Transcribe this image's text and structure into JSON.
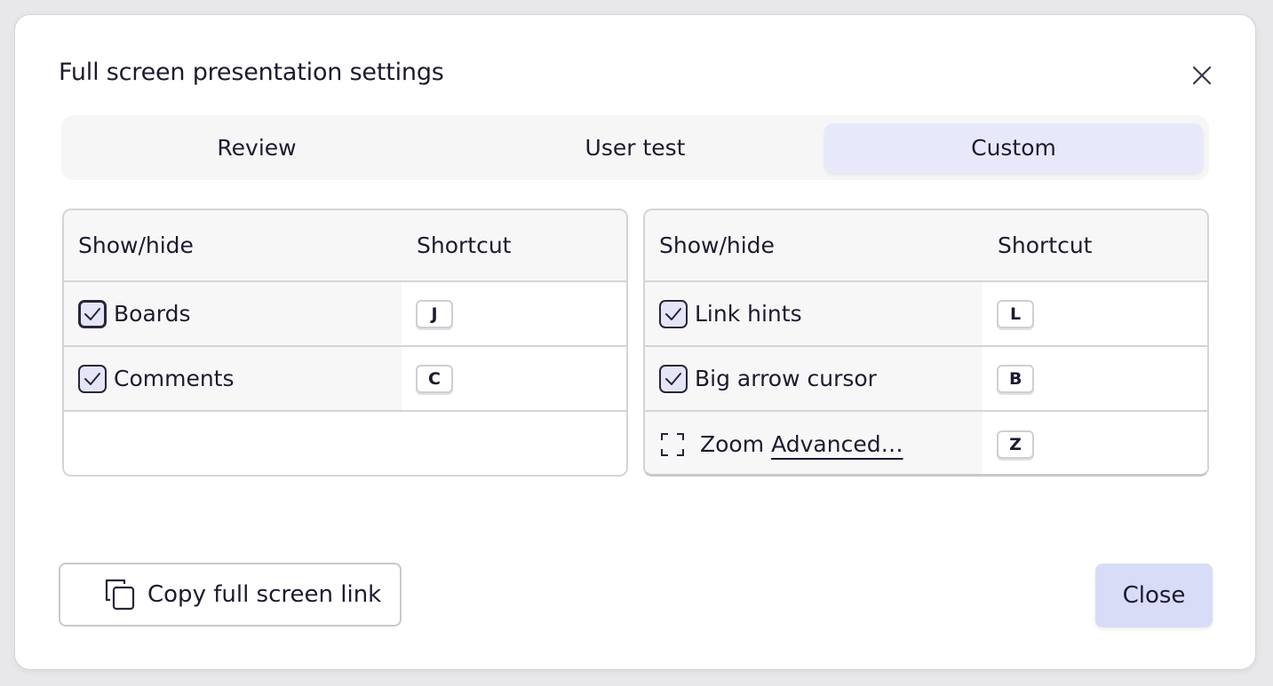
{
  "dialog": {
    "title": "Full screen presentation settings"
  },
  "tabs": [
    {
      "label": "Review",
      "active": false
    },
    {
      "label": "User test",
      "active": false
    },
    {
      "label": "Custom",
      "active": true
    }
  ],
  "left_panel": {
    "header": {
      "show_hide": "Show/hide",
      "shortcut": "Shortcut"
    },
    "rows": [
      {
        "label": "Boards",
        "checked": true,
        "shortcut": "J"
      },
      {
        "label": "Comments",
        "checked": true,
        "shortcut": "C"
      }
    ]
  },
  "right_panel": {
    "header": {
      "show_hide": "Show/hide",
      "shortcut": "Shortcut"
    },
    "rows": [
      {
        "label": "Link hints",
        "checked": true,
        "shortcut": "L"
      },
      {
        "label": "Big arrow cursor",
        "checked": true,
        "shortcut": "B"
      },
      {
        "label": "Zoom",
        "link": "Advanced…",
        "checked": false,
        "shortcut": "Z"
      }
    ]
  },
  "footer": {
    "copy_label": "Copy full screen link",
    "close_label": "Close"
  },
  "icons": {
    "close": "close-icon",
    "checkbox": "checkmark-icon",
    "zoom": "zoom-frame-icon",
    "copy": "copy-icon"
  }
}
